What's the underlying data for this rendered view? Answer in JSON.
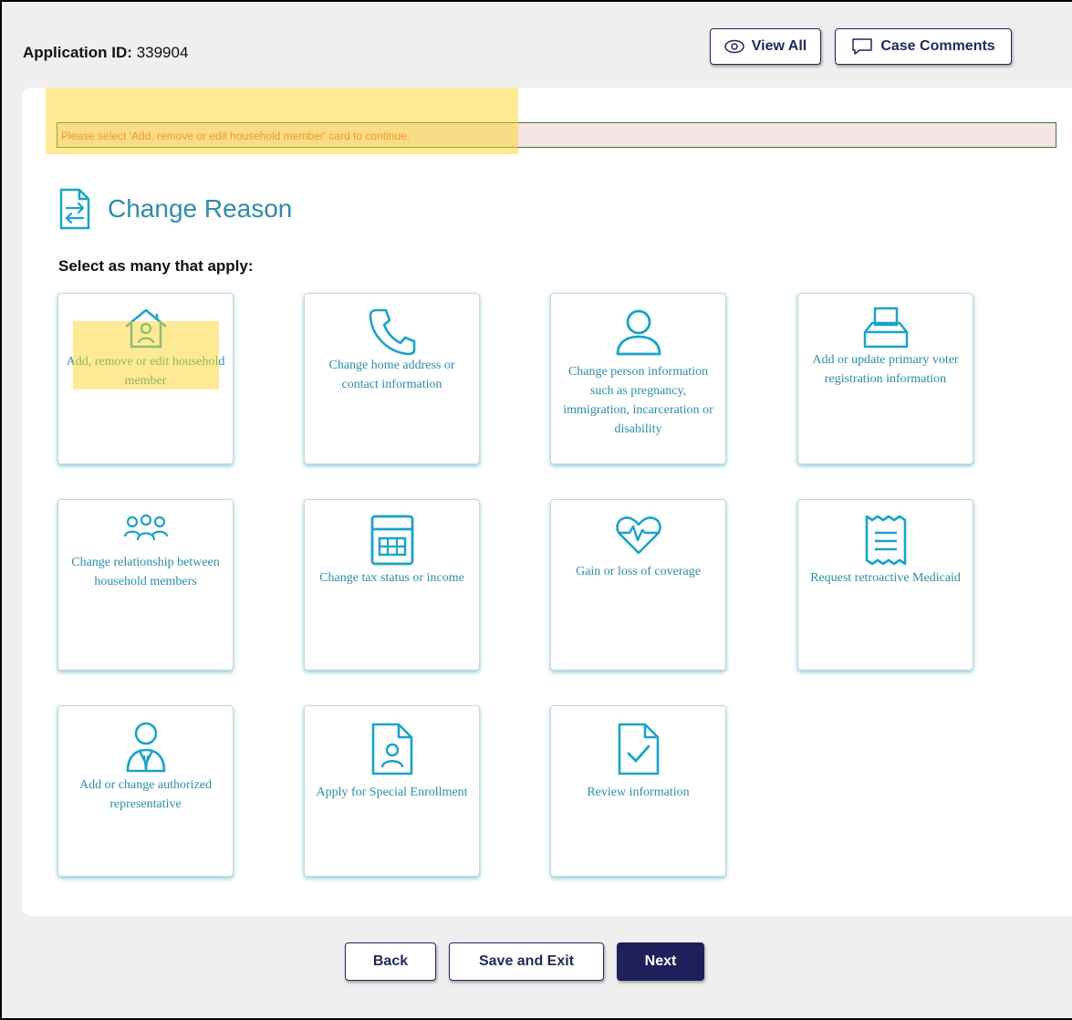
{
  "header": {
    "app_id_label": "Application ID:",
    "app_id_value": "339904",
    "view_all_label": "View All",
    "case_comments_label": "Case Comments"
  },
  "alert": {
    "message": "Please select 'Add, remove or edit household member' card to continue."
  },
  "page": {
    "title": "Change Reason",
    "subtitle": "Select as many that apply:"
  },
  "cards": [
    {
      "label": "Add, remove or edit household member",
      "icon": "house-person-icon"
    },
    {
      "label": "Change home address or contact information",
      "icon": "phone-icon"
    },
    {
      "label": "Change person information such as pregnancy, immigration, incarceration or disability",
      "icon": "person-icon"
    },
    {
      "label": "Add or update primary voter registration information",
      "icon": "ballot-box-icon"
    },
    {
      "label": "Change relationship between household members",
      "icon": "group-icon"
    },
    {
      "label": "Change tax status or income",
      "icon": "calculator-icon"
    },
    {
      "label": "Gain or loss of coverage",
      "icon": "heart-pulse-icon"
    },
    {
      "label": "Request retroactive Medicaid",
      "icon": "receipt-icon"
    },
    {
      "label": "Add or change authorized representative",
      "icon": "representative-icon"
    },
    {
      "label": "Apply for Special Enrollment",
      "icon": "document-person-icon"
    },
    {
      "label": "Review information",
      "icon": "document-check-icon"
    }
  ],
  "footer": {
    "back_label": "Back",
    "save_exit_label": "Save and Exit",
    "next_label": "Next"
  },
  "colors": {
    "accent": "#2b8ea8",
    "icon": "#1aa3c8",
    "primary_button": "#1f1f5c",
    "alert_text": "#e8542a",
    "highlight": "#fdd62a"
  }
}
